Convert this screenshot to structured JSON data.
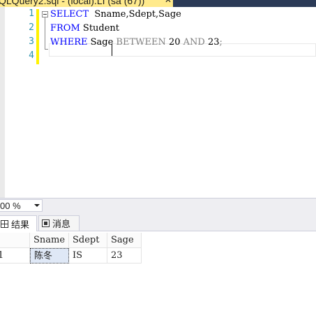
{
  "window": {
    "tab_title": "QLQuery2.sql - (local).LI (sa (67))"
  },
  "editor": {
    "line_numbers": [
      "1",
      "2",
      "3",
      "4"
    ],
    "lines": [
      {
        "kw1": "SELECT",
        "text1": "  Sname,Sdept,Sage"
      },
      {
        "kw1": "FROM",
        "text1": " Student"
      },
      {
        "kw1": "WHERE",
        "text1": " Sage ",
        "op1": "BETWEEN",
        "text2": " 20 ",
        "op2": "AND",
        "text3": " 23",
        "op3": ";"
      }
    ],
    "colors": {
      "keyword": "#0000ff",
      "operator": "#808080",
      "line_number": "#2b91af",
      "change_bar": "#fff200"
    }
  },
  "status": {
    "zoom": "00 %"
  },
  "result_tabs": [
    {
      "label": "结果",
      "icon": "grid-icon",
      "active": true
    },
    {
      "label": "消息",
      "icon": "message-icon",
      "active": false
    }
  ],
  "results": {
    "columns": [
      "Sname",
      "Sdept",
      "Sage"
    ],
    "rows": [
      {
        "row_no": "1",
        "cells": [
          "陈冬",
          "IS",
          "23"
        ]
      }
    ]
  }
}
